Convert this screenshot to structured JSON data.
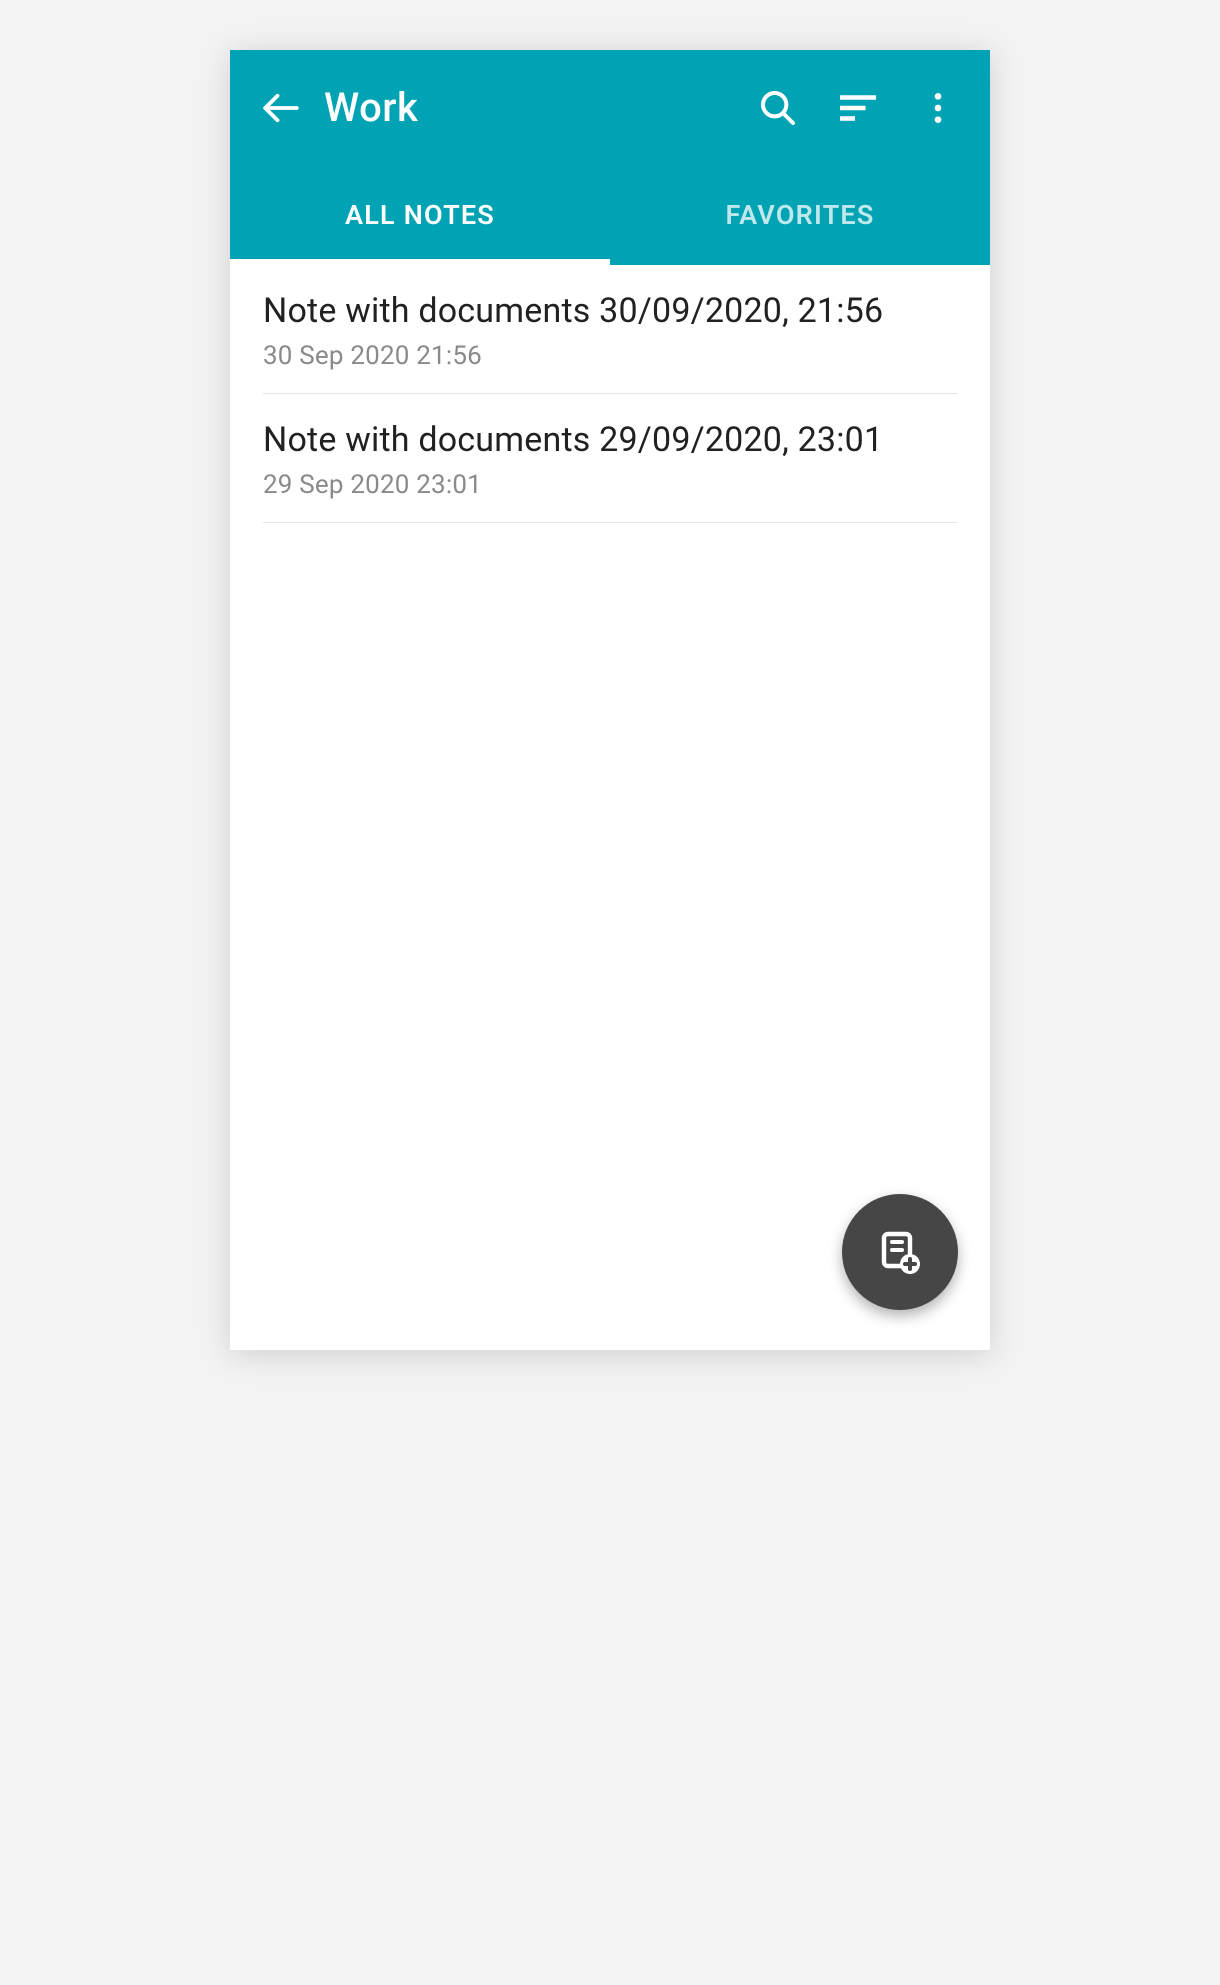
{
  "header": {
    "title": "Work"
  },
  "tabs": {
    "all_notes": "ALL NOTES",
    "favorites": "FAVORITES"
  },
  "notes": [
    {
      "title": "Note with documents 30/09/2020, 21:56",
      "date": "30 Sep 2020 21:56"
    },
    {
      "title": "Note with documents 29/09/2020, 23:01",
      "date": "29 Sep 2020 23:01"
    }
  ],
  "colors": {
    "primary": "#00a3b3",
    "fab": "#464646"
  }
}
